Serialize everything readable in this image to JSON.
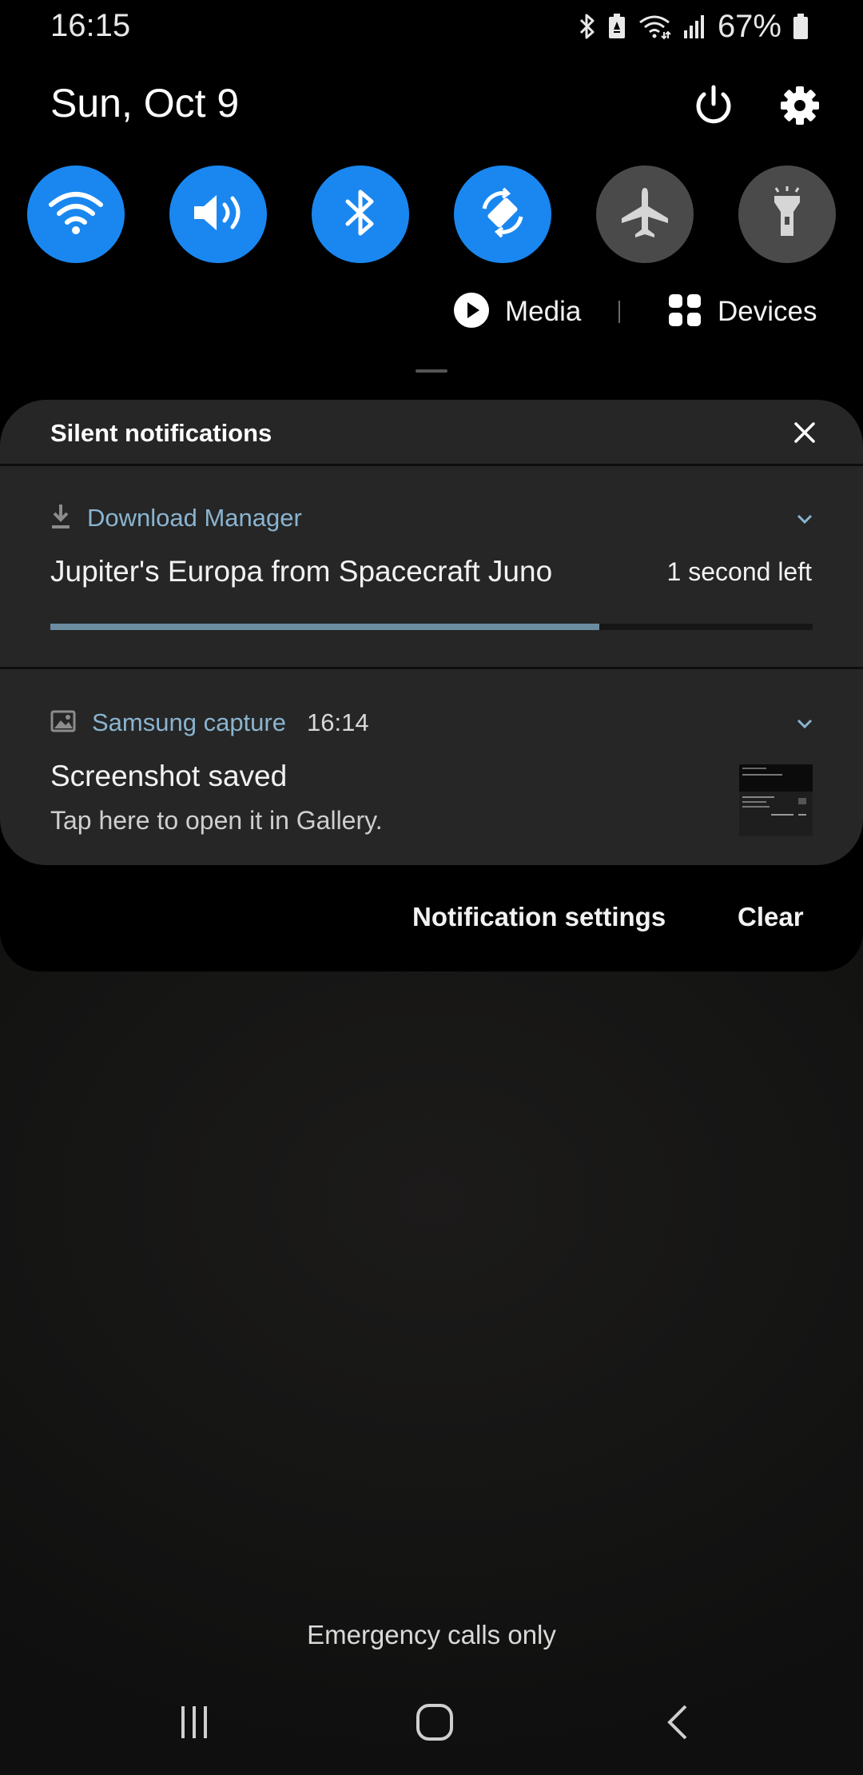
{
  "status_bar": {
    "time": "16:15",
    "battery_percent": "67%",
    "icons": [
      "bluetooth-icon",
      "battery-saver-icon",
      "wifi-data-icon",
      "cell-signal-icon",
      "battery-icon"
    ]
  },
  "header": {
    "date": "Sun, Oct 9",
    "power_icon": "power-icon",
    "settings_icon": "gear-icon"
  },
  "quick_toggles": [
    {
      "name": "wifi",
      "icon": "wifi-icon",
      "on": true
    },
    {
      "name": "sound",
      "icon": "volume-icon",
      "on": true
    },
    {
      "name": "bluetooth",
      "icon": "bluetooth-icon",
      "on": true
    },
    {
      "name": "auto-rotate",
      "icon": "rotate-icon",
      "on": true
    },
    {
      "name": "airplane-mode",
      "icon": "airplane-icon",
      "on": false
    },
    {
      "name": "flashlight",
      "icon": "flashlight-icon",
      "on": false
    }
  ],
  "media": {
    "label": "Media"
  },
  "devices": {
    "label": "Devices"
  },
  "panel": {
    "title": "Silent notifications",
    "notifications": [
      {
        "app": "Download Manager",
        "title": "Jupiter's Europa from Spacecraft Juno",
        "right_text": "1 second left",
        "progress": 0.72
      },
      {
        "app": "Samsung capture",
        "time": "16:14",
        "title": "Screenshot saved",
        "subtitle": "Tap here to open it in Gallery."
      }
    ]
  },
  "actions": {
    "settings_label": "Notification settings",
    "clear_label": "Clear"
  },
  "footer": {
    "emergency": "Emergency calls only"
  },
  "colors": {
    "toggle_on": "#1a87f0",
    "toggle_off": "#4a4a4a",
    "app_name": "#8ab4d0",
    "progress": "#6a8ba0"
  }
}
